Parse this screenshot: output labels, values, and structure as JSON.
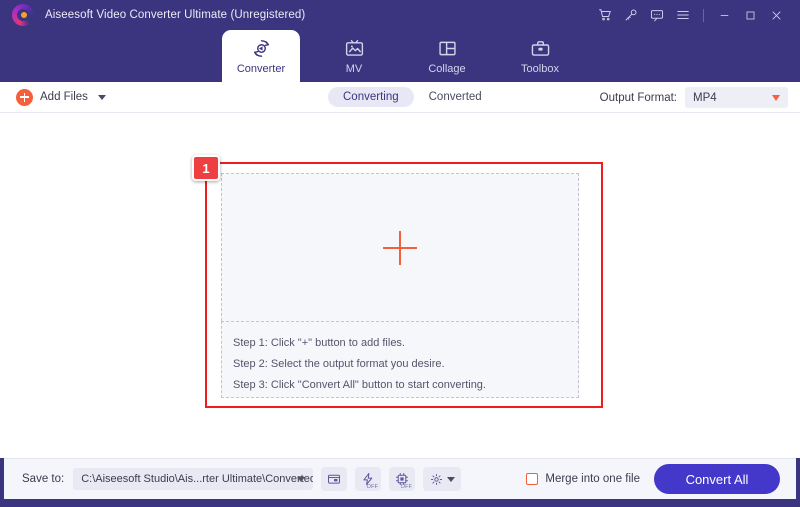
{
  "window": {
    "title": "Aiseesoft Video Converter Ultimate (Unregistered)",
    "logo_icon": "aiseesoft-logo-icon",
    "controls": [
      {
        "name": "cart-icon",
        "glyph": "cart"
      },
      {
        "name": "key-icon",
        "glyph": "key"
      },
      {
        "name": "feedback-icon",
        "glyph": "chat"
      },
      {
        "name": "menu-icon",
        "glyph": "hamburger"
      },
      {
        "name": "minimize-icon",
        "glyph": "minimize"
      },
      {
        "name": "maximize-icon",
        "glyph": "maximize"
      },
      {
        "name": "close-icon",
        "glyph": "close"
      }
    ],
    "colors": {
      "header_purple": "#3b3580",
      "accent_orange": "#f4603c",
      "accent_indigo": "#4338ca",
      "annotation_red": "#ef1d1d"
    }
  },
  "nav": {
    "tabs": [
      {
        "label": "Converter",
        "icon": "converter-icon",
        "active": true
      },
      {
        "label": "MV",
        "icon": "mv-icon",
        "active": false
      },
      {
        "label": "Collage",
        "icon": "collage-icon",
        "active": false
      },
      {
        "label": "Toolbox",
        "icon": "toolbox-icon",
        "active": false
      }
    ]
  },
  "toolbar": {
    "add_files_label": "Add Files",
    "add_files_icon": "plus-circle-icon",
    "add_files_caret": "chevron-down-icon",
    "segments": [
      {
        "label": "Converting",
        "active": true
      },
      {
        "label": "Converted",
        "active": false
      }
    ],
    "output_format_label": "Output Format:",
    "output_format_value": "MP4",
    "output_format_caret": "chevron-down-icon"
  },
  "dropzone": {
    "plus_icon": "plus-icon",
    "steps": [
      "Step 1: Click \"+\" button to add files.",
      "Step 2: Select the output format you desire.",
      "Step 3: Click \"Convert All\" button to start converting."
    ]
  },
  "annotation": {
    "badge_number": "1"
  },
  "bottom": {
    "save_to_label": "Save to:",
    "save_to_path": "C:\\Aiseesoft Studio\\Ais...rter Ultimate\\Converted",
    "save_to_caret": "chevron-down-icon",
    "icons": [
      {
        "name": "open-folder-icon",
        "off_label": ""
      },
      {
        "name": "hardware-acceleration-icon",
        "off_label": "OFF"
      },
      {
        "name": "gpu-acceleration-icon",
        "off_label": "OFF"
      },
      {
        "name": "settings-gear-icon",
        "off_label": ""
      }
    ],
    "merge_label": "Merge into one file",
    "merge_checked": false,
    "convert_all_label": "Convert All"
  }
}
